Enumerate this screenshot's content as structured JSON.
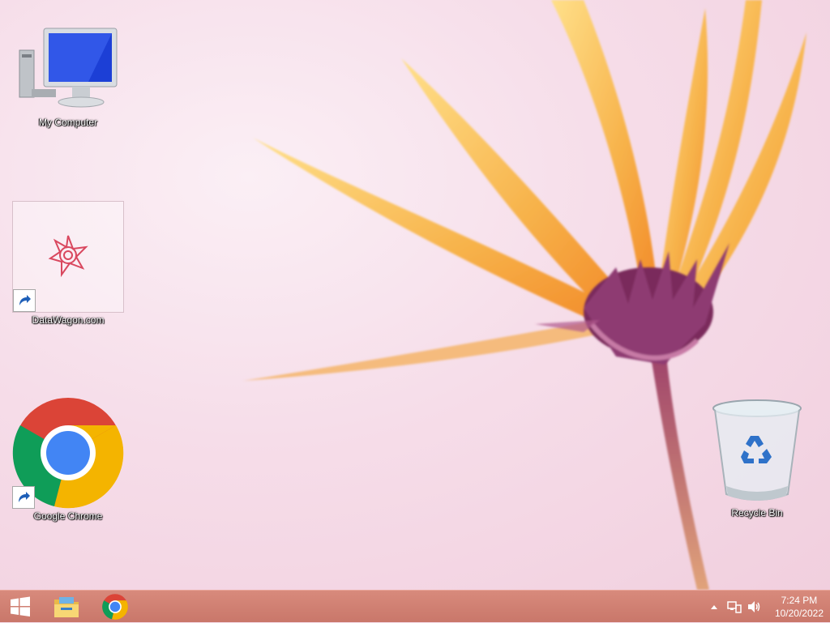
{
  "desktop": {
    "icons": [
      {
        "label": "My Computer",
        "icon": "computer-icon"
      },
      {
        "label": "DataWagon.com",
        "icon": "datawagon-shortcut-icon"
      },
      {
        "label": "Google Chrome",
        "icon": "chrome-icon"
      },
      {
        "label": "Recycle Bin",
        "icon": "recycle-bin-icon"
      }
    ]
  },
  "taskbar": {
    "start": "windows-logo-icon",
    "pinned": [
      "file-explorer-icon",
      "chrome-icon"
    ],
    "tray": [
      "show-hidden-icons-arrow",
      "network-icon",
      "volume-icon"
    ],
    "clock": {
      "time": "7:24 PM",
      "date": "10/20/2022"
    }
  },
  "colors": {
    "taskbar": "#cf7f72",
    "wallpaper_bg": "#f6dde9",
    "petal": "#f6a93a"
  }
}
